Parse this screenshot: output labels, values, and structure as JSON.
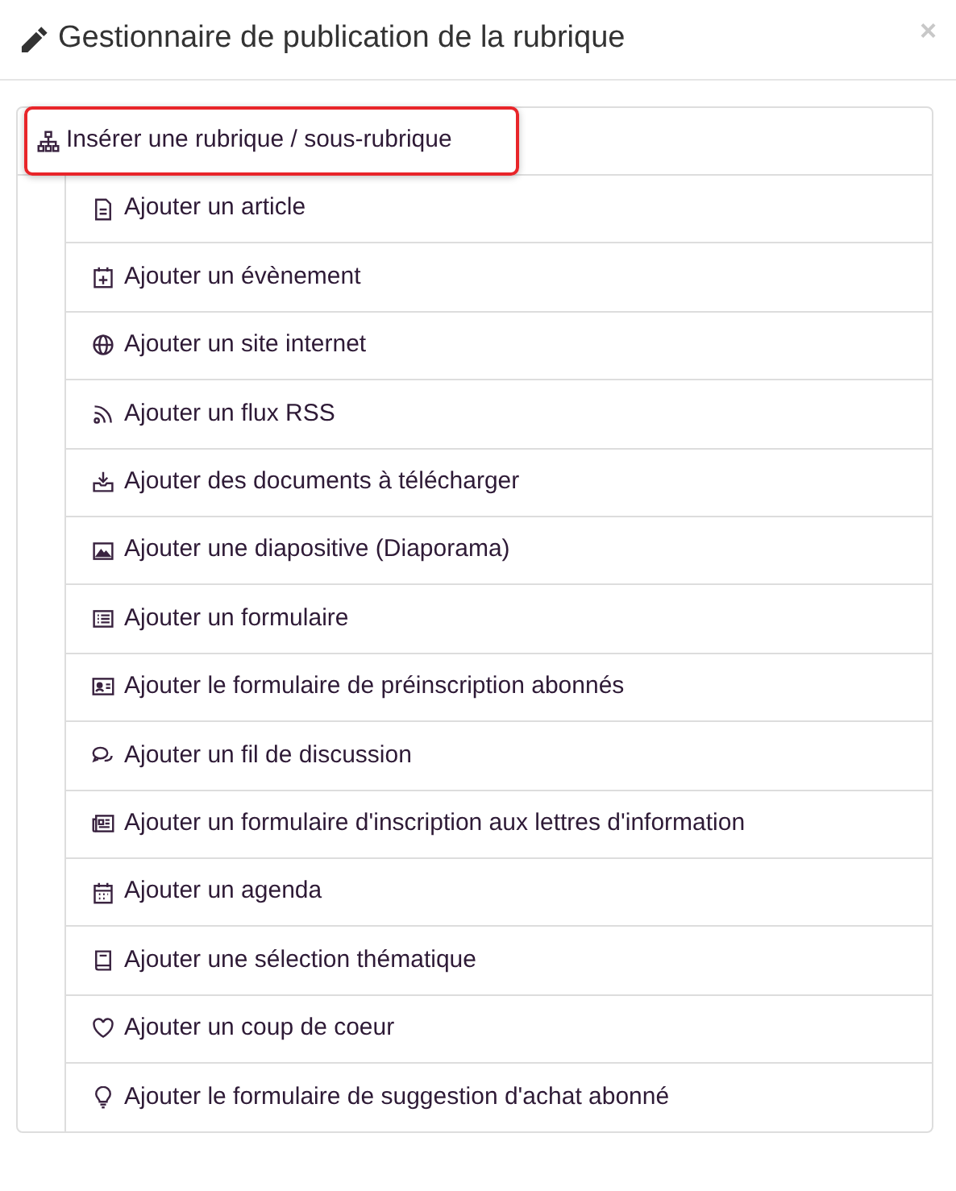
{
  "dialog": {
    "title": "Gestionnaire de publication de la rubrique",
    "close": "×"
  },
  "root": {
    "label": "Insérer une rubrique / sous-rubrique",
    "highlighted": true,
    "children": [
      {
        "label": "Ajouter un article"
      },
      {
        "label": "Ajouter un évènement"
      },
      {
        "label": "Ajouter un site internet"
      },
      {
        "label": "Ajouter un flux RSS"
      },
      {
        "label": "Ajouter des documents à télécharger"
      },
      {
        "label": "Ajouter une diapositive (Diaporama)"
      },
      {
        "label": "Ajouter un formulaire"
      },
      {
        "label": "Ajouter le formulaire de préinscription abonnés"
      },
      {
        "label": "Ajouter un fil de discussion"
      },
      {
        "label": "Ajouter un formulaire d'inscription aux lettres d'information"
      },
      {
        "label": "Ajouter un agenda"
      },
      {
        "label": "Ajouter une sélection thématique"
      },
      {
        "label": "Ajouter un coup de coeur"
      },
      {
        "label": "Ajouter le formulaire de suggestion d'achat abonné"
      }
    ]
  }
}
